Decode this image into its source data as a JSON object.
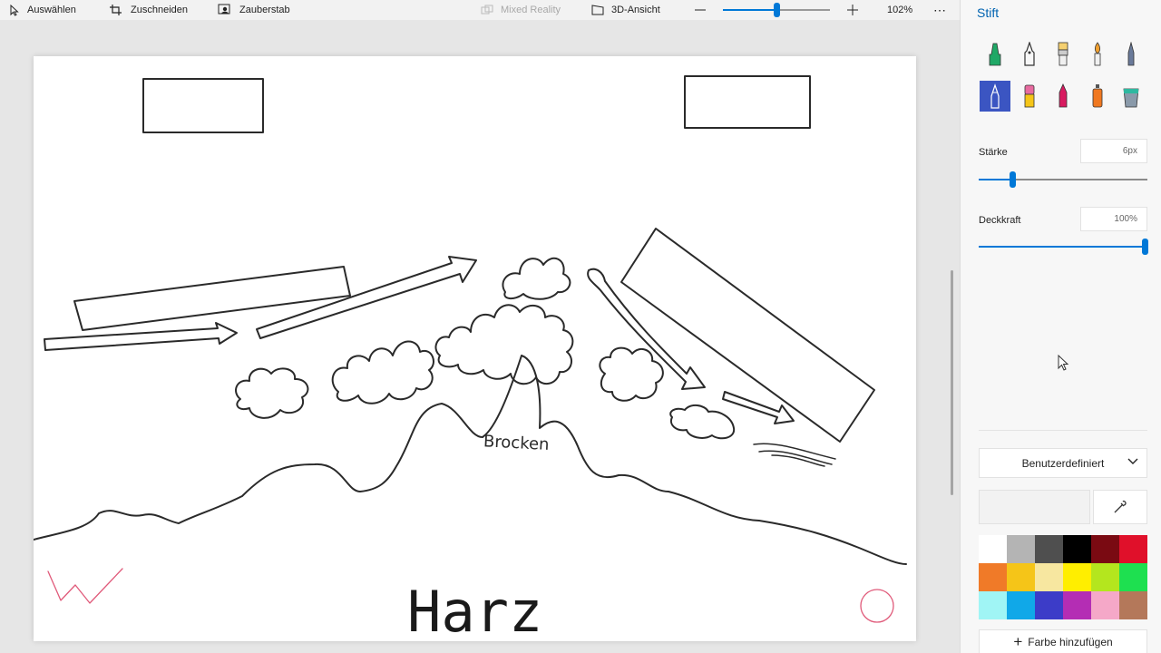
{
  "toolbar": {
    "select_label": "Auswählen",
    "crop_label": "Zuschneiden",
    "magic_select_label": "Zauberstab",
    "mixed_reality_label": "Mixed Reality",
    "view_3d_label": "3D-Ansicht",
    "zoom_value": "102%",
    "zoom_slider_fraction": 0.5,
    "more_label": "⋯"
  },
  "canvas": {
    "drawing_text": {
      "peak_label": "Brocken",
      "title": "Harz"
    }
  },
  "panel": {
    "title": "Stift",
    "tools": [
      {
        "name": "marker",
        "color": "#1fa866"
      },
      {
        "name": "calligraphy-pen",
        "color": "#5a6a7a"
      },
      {
        "name": "oil-brush",
        "color": "#e8b84a"
      },
      {
        "name": "watercolor",
        "color": "#f0a030"
      },
      {
        "name": "pixel-pen",
        "color": "#6a7a9a"
      },
      {
        "name": "pencil",
        "color": "#ffffff",
        "selected": true
      },
      {
        "name": "eraser",
        "color": "#e86aa0"
      },
      {
        "name": "crayon",
        "color": "#d81b60"
      },
      {
        "name": "spray-can",
        "color": "#f07820"
      },
      {
        "name": "fill-bucket",
        "color": "#2fb8a0"
      }
    ],
    "thickness_label": "Stärke",
    "thickness_value": "6px",
    "thickness_fraction": 0.2,
    "opacity_label": "Deckkraft",
    "opacity_value": "100%",
    "opacity_fraction": 1.0,
    "dropdown_label": "Benutzerdefiniert",
    "add_color_label": "Farbe hinzufügen",
    "palette": [
      "#ffffff",
      "#b4b4b4",
      "#4f4f4f",
      "#000000",
      "#7a0a12",
      "#e0102a",
      "#f07a28",
      "#f5c518",
      "#f7e7a0",
      "#ffee00",
      "#b4e61e",
      "#1ee050",
      "#a0f5f5",
      "#10a8e8",
      "#3c3cc8",
      "#b42db4",
      "#f5a8c8",
      "#b4785a"
    ],
    "accent": "#0078d7"
  }
}
